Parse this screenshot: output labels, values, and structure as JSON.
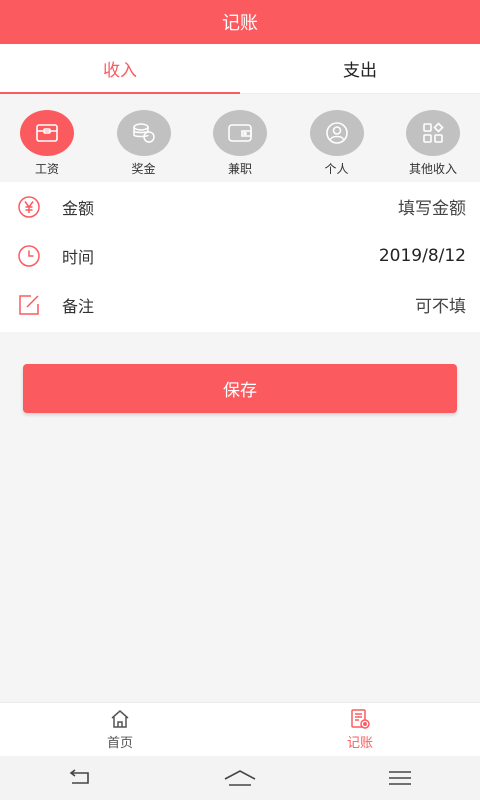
{
  "header": {
    "title": "记账"
  },
  "tabs": [
    {
      "label": "收入",
      "active": true
    },
    {
      "label": "支出",
      "active": false
    }
  ],
  "categories": [
    {
      "label": "工资",
      "icon": "wallet-icon",
      "active": true
    },
    {
      "label": "奖金",
      "icon": "coins-icon",
      "active": false
    },
    {
      "label": "兼职",
      "icon": "purse-icon",
      "active": false
    },
    {
      "label": "个人",
      "icon": "person-icon",
      "active": false
    },
    {
      "label": "其他收入",
      "icon": "grid-icon",
      "active": false
    }
  ],
  "form": {
    "amount": {
      "label": "金额",
      "value": "填写金额",
      "icon": "yen-icon"
    },
    "time": {
      "label": "时间",
      "value": "2019/8/12",
      "icon": "clock-icon"
    },
    "note": {
      "label": "备注",
      "value": "可不填",
      "icon": "edit-icon"
    }
  },
  "save_label": "保存",
  "bottom_nav": [
    {
      "label": "首页",
      "icon": "home-icon",
      "active": false
    },
    {
      "label": "记账",
      "icon": "ledger-icon",
      "active": true
    }
  ],
  "system_nav": [
    "back-icon",
    "home-key-icon",
    "menu-icon"
  ],
  "colors": {
    "accent": "#fb5b5f",
    "inactive_circle": "#c1c1c1"
  }
}
